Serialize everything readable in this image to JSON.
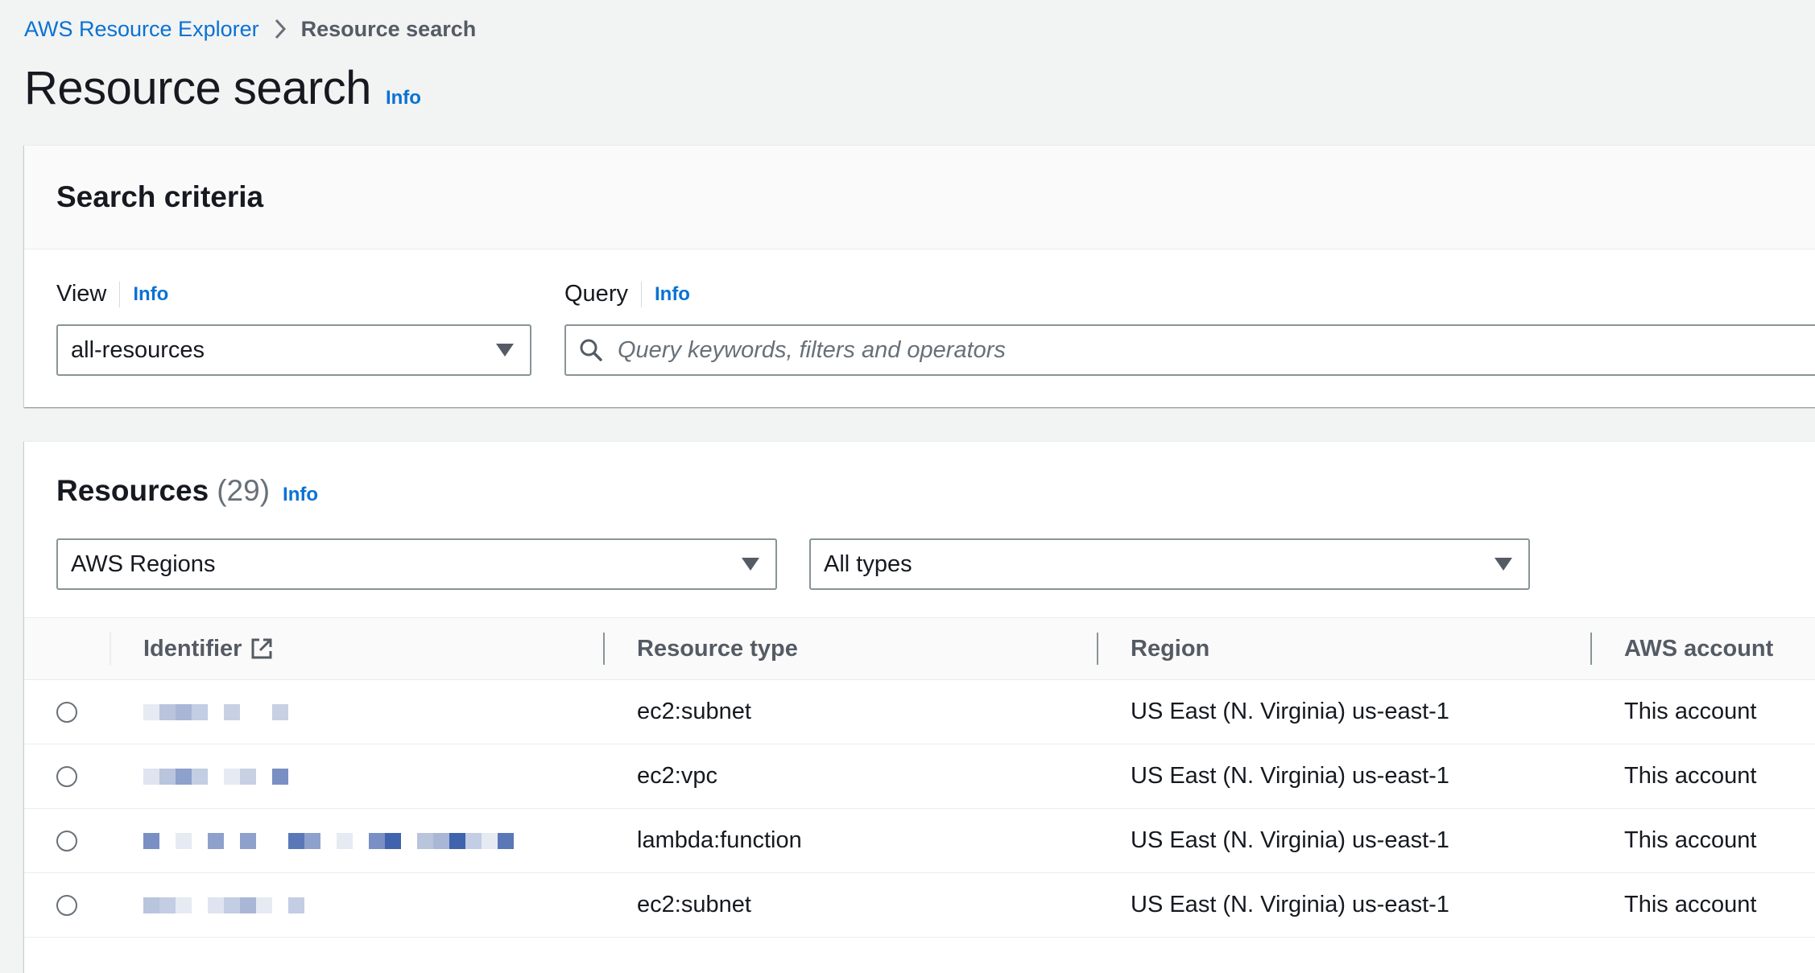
{
  "breadcrumb": {
    "parent": "AWS Resource Explorer",
    "current": "Resource search"
  },
  "page": {
    "title": "Resource search",
    "info": "Info"
  },
  "search_criteria": {
    "title": "Search criteria",
    "view_label": "View",
    "view_info": "Info",
    "view_value": "all-resources",
    "query_label": "Query",
    "query_info": "Info",
    "query_placeholder": "Query keywords, filters and operators"
  },
  "resources": {
    "title": "Resources",
    "count": "(29)",
    "info": "Info",
    "regions_filter": "AWS Regions",
    "types_filter": "All types",
    "columns": [
      "Identifier",
      "Resource type",
      "Region",
      "AWS account"
    ],
    "rows": [
      {
        "resource_type": "ec2:subnet",
        "region": "US East (N. Virginia) us-east-1",
        "account": "This account"
      },
      {
        "resource_type": "ec2:vpc",
        "region": "US East (N. Virginia) us-east-1",
        "account": "This account"
      },
      {
        "resource_type": "lambda:function",
        "region": "US East (N. Virginia) us-east-1",
        "account": "This account"
      },
      {
        "resource_type": "ec2:subnet",
        "region": "US East (N. Virginia) us-east-1",
        "account": "This account"
      }
    ]
  },
  "icons": {
    "breadcrumb_separator": "chevron-right-icon",
    "search": "search-icon",
    "dropdown": "caret-down-icon",
    "external_link": "external-link-icon",
    "row_select": "radio-icon"
  },
  "colors": {
    "link": "#0972d3",
    "background": "#f2f3f3",
    "text": "#16191f",
    "muted": "#545b64"
  }
}
